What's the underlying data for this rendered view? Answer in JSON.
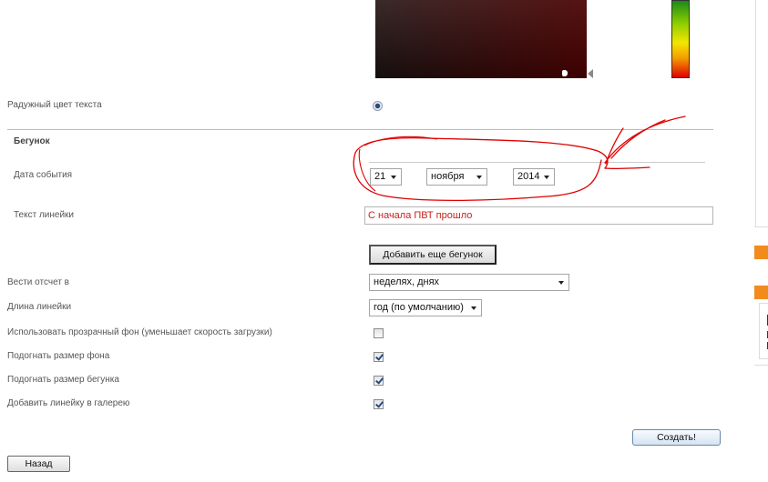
{
  "color_picker": {
    "accent_colors": [
      "#1a8a1a",
      "#8fce00",
      "#f3e600",
      "#f39c00",
      "#e00000"
    ]
  },
  "rainbow_text": {
    "label": "Радужный цвет текста",
    "selected": true
  },
  "ticker_section": {
    "title": "Бегунок",
    "event_date": {
      "label": "Дата события",
      "day": "21",
      "month": "ноября",
      "year": "2014"
    },
    "line_text": {
      "label": "Текст линейки",
      "value": "С начала  ПВТ прошло",
      "text_color": "#c8211b"
    },
    "add_button": "Добавить еще бегунок"
  },
  "settings": {
    "count_in": {
      "label": "Вести отсчет в",
      "value": "неделях, днях"
    },
    "line_length": {
      "label": "Длина линейки",
      "value": "год (по умолчанию)"
    },
    "checkboxes": [
      {
        "label": "Использовать прозрачный фон (уменьшает скорость загрузки)",
        "checked": false
      },
      {
        "label": "Подогнать размер фона",
        "checked": true
      },
      {
        "label": "Подогнать размер бегунка",
        "checked": true
      },
      {
        "label": "Добавить линейку в галерею",
        "checked": true
      }
    ]
  },
  "actions": {
    "create": "Создать!",
    "back": "Назад"
  },
  "annotation": {
    "color": "#e00000"
  }
}
